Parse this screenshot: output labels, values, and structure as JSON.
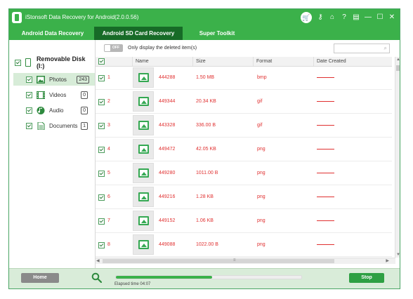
{
  "window": {
    "title": "iStonsoft Data Recovery for Android(2.0.0.56)"
  },
  "titlebar_icons": [
    "cart-icon",
    "key-icon",
    "home-icon",
    "help-icon",
    "register-icon",
    "minimize-icon",
    "maximize-icon",
    "close-icon"
  ],
  "titlebar_glyphs": {
    "cart": "🛒",
    "key": "⚷",
    "home": "⌂",
    "help": "?",
    "register": "▤",
    "minimize": "—",
    "maximize": "☐",
    "close": "✕"
  },
  "tabs": [
    {
      "label": "Android Data Recovery",
      "active": false
    },
    {
      "label": "Android SD Card Recovery",
      "active": true
    },
    {
      "label": "Super Toolkit",
      "active": false
    }
  ],
  "sidebar": {
    "disk_label": "Removable Disk (I:)",
    "items": [
      {
        "label": "Photos",
        "count": "243",
        "selected": true,
        "icon": "photo-icon"
      },
      {
        "label": "Videos",
        "count": "0",
        "selected": false,
        "icon": "video-icon"
      },
      {
        "label": "Audio",
        "count": "0",
        "selected": false,
        "icon": "audio-icon"
      },
      {
        "label": "Documents",
        "count": "1",
        "selected": false,
        "icon": "document-icon"
      }
    ]
  },
  "toolbar": {
    "toggle_text": "OFF",
    "deleted_only_label": "Only display the deleted item(s)",
    "search_placeholder": ""
  },
  "table": {
    "columns": [
      "Name",
      "Size",
      "Format",
      "Date Created"
    ],
    "rows": [
      {
        "num": "1",
        "name": "444288",
        "size": "1.50 MB",
        "format": "bmp"
      },
      {
        "num": "2",
        "name": "449344",
        "size": "20.34 KB",
        "format": "gif"
      },
      {
        "num": "3",
        "name": "443328",
        "size": "336.00 B",
        "format": "gif"
      },
      {
        "num": "4",
        "name": "449472",
        "size": "42.05 KB",
        "format": "png"
      },
      {
        "num": "5",
        "name": "449280",
        "size": "1011.00 B",
        "format": "png"
      },
      {
        "num": "6",
        "name": "449216",
        "size": "1.28 KB",
        "format": "png"
      },
      {
        "num": "7",
        "name": "449152",
        "size": "1.06 KB",
        "format": "png"
      },
      {
        "num": "8",
        "name": "449088",
        "size": "1022.00 B",
        "format": "png"
      }
    ]
  },
  "footer": {
    "home_label": "Home",
    "progress_fraction": 0.52,
    "elapsed_label": "Elapsed time 04:07",
    "stop_label": "Stop"
  },
  "colors": {
    "accent": "#3bb14a",
    "active_tab": "#176b27",
    "value_text": "#e03030"
  }
}
